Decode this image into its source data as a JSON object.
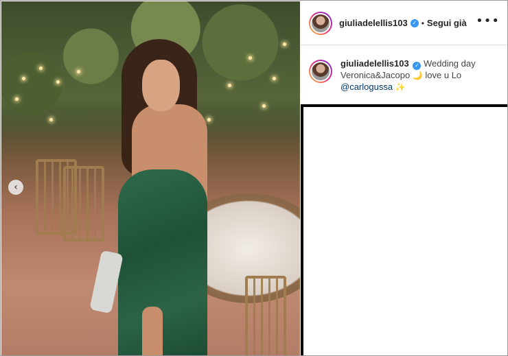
{
  "post": {
    "username": "giuliadelellis103",
    "verified": true,
    "follow_status": "Segui già",
    "separator": "•",
    "more_icon": "more-horizontal-icon",
    "caption": {
      "username": "giuliadelellis103",
      "text_1": "Wedding day Veronica&Jacopo",
      "emoji_1": "🌙",
      "text_2": "love u Lo",
      "mention": "@carlogussa",
      "emoji_2": "✨"
    }
  },
  "carousel": {
    "prev_icon": "chevron-left-icon",
    "prev_glyph": "‹"
  },
  "colors": {
    "verified": "#3897f0",
    "mention": "#00376b",
    "dress": "#1f5238"
  }
}
